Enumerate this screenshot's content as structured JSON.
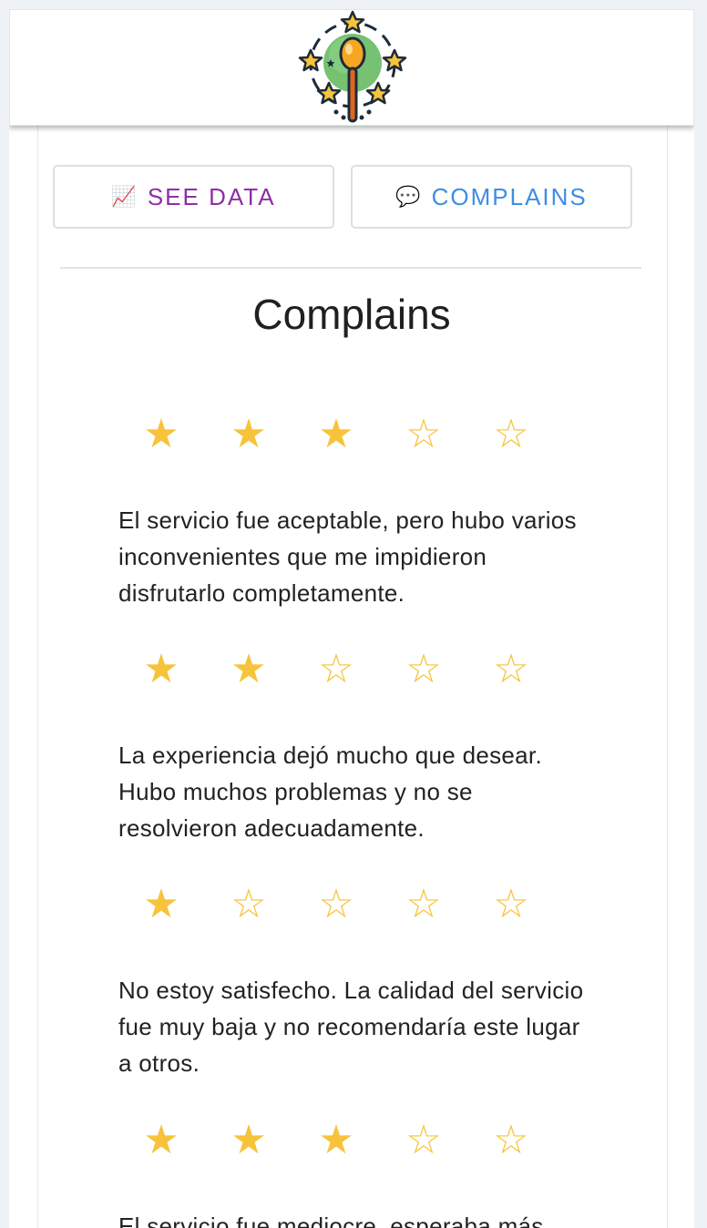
{
  "header": {
    "logo_icon": "spoon-stars-logo-icon"
  },
  "tabs": [
    {
      "icon": "📈",
      "icon_name": "chart-increasing-icon",
      "label": "SEE DATA",
      "color": "#8e2fa6"
    },
    {
      "icon": "💬",
      "icon_name": "speech-bubble-icon",
      "label": "COMPLAINS",
      "color": "#3f8de3"
    }
  ],
  "section": {
    "title": "Complains"
  },
  "star_color": "#f7c33a",
  "reviews": [
    {
      "rating": 3,
      "max": 5,
      "text": "El servicio fue aceptable, pero hubo varios inconvenientes que me impidieron disfrutarlo completamente."
    },
    {
      "rating": 2,
      "max": 5,
      "text": "La experiencia dejó mucho que desear. Hubo muchos problemas y no se resolvieron adecuadamente."
    },
    {
      "rating": 1,
      "max": 5,
      "text": "No estoy satisfecho. La calidad del servicio fue muy baja y no recomendaría este lugar a otros."
    },
    {
      "rating": 3,
      "max": 5,
      "text": "El servicio fue mediocre, esperaba más."
    }
  ]
}
